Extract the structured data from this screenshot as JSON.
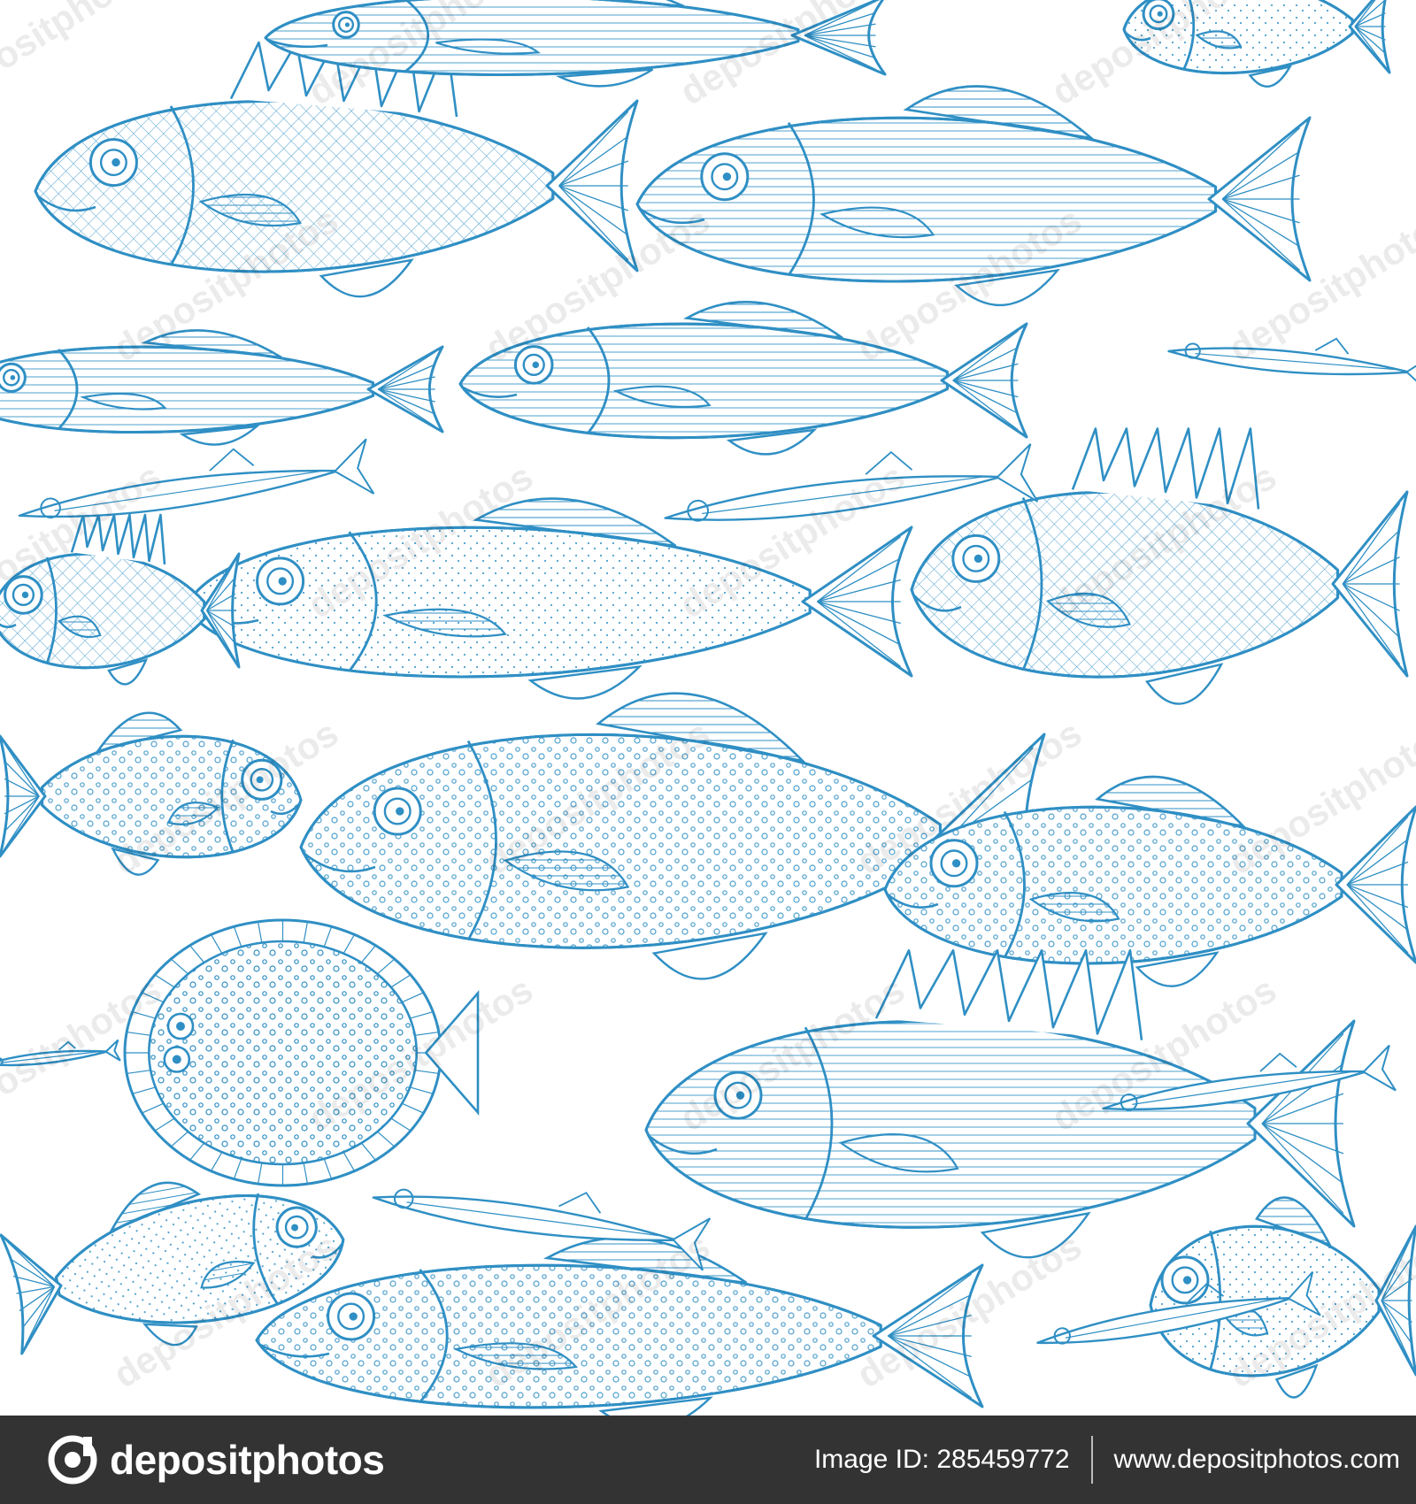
{
  "colors": {
    "ink": "#2F8FC4",
    "background": "#ffffff",
    "footer": "#333333"
  },
  "footer": {
    "logo_text": "depositphotos",
    "logo_icon": "depositphotos-logo-icon",
    "image_id": "Image ID: 285459772",
    "site_url": "www.depositphotos.com"
  },
  "watermark_text": "depositphotos"
}
